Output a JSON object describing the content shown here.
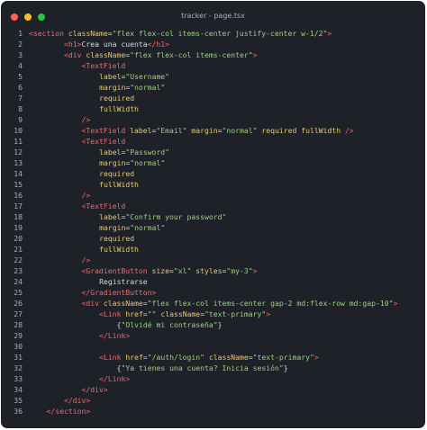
{
  "window": {
    "title": "tracker - page.tsx",
    "traffic_lights": [
      {
        "name": "close",
        "color": "#ff5f57"
      },
      {
        "name": "minimize",
        "color": "#febc2e"
      },
      {
        "name": "maximize",
        "color": "#28c840"
      }
    ]
  },
  "colors": {
    "background": "#1e2228",
    "line_number": "#a9aeb7",
    "tag": "#e36f6f",
    "attribute": "#e8c770",
    "string": "#9ad07f",
    "text": "#d6d8dc"
  },
  "code_lines": [
    {
      "n": "1",
      "indent": 0,
      "tokens": [
        [
          "tag",
          "<section "
        ],
        [
          "attr",
          "className"
        ],
        [
          "txtc",
          "="
        ],
        [
          "str",
          "\"flex flex-col items-center justify-center w-1/2\""
        ],
        [
          "tag",
          ">"
        ]
      ]
    },
    {
      "n": "2",
      "indent": 8,
      "tokens": [
        [
          "tag",
          "<h1>"
        ],
        [
          "txtc",
          "Crea una cuenta"
        ],
        [
          "tag",
          "</h1>"
        ]
      ]
    },
    {
      "n": "3",
      "indent": 8,
      "tokens": [
        [
          "tag",
          "<div "
        ],
        [
          "attr",
          "className"
        ],
        [
          "txtc",
          "="
        ],
        [
          "str",
          "\"flex flex-col items-center\""
        ],
        [
          "tag",
          ">"
        ]
      ]
    },
    {
      "n": "4",
      "indent": 12,
      "tokens": [
        [
          "tag",
          "<TextField"
        ]
      ]
    },
    {
      "n": "5",
      "indent": 16,
      "tokens": [
        [
          "attr",
          "label"
        ],
        [
          "txtc",
          "="
        ],
        [
          "str",
          "\"Username\""
        ]
      ]
    },
    {
      "n": "6",
      "indent": 16,
      "tokens": [
        [
          "attr",
          "margin"
        ],
        [
          "txtc",
          "="
        ],
        [
          "str",
          "\"normal\""
        ]
      ]
    },
    {
      "n": "7",
      "indent": 16,
      "tokens": [
        [
          "attr",
          "required"
        ]
      ]
    },
    {
      "n": "8",
      "indent": 16,
      "tokens": [
        [
          "attr",
          "fullWidth"
        ]
      ]
    },
    {
      "n": "9",
      "indent": 12,
      "tokens": [
        [
          "tag",
          "/>"
        ]
      ]
    },
    {
      "n": "10",
      "indent": 12,
      "tokens": [
        [
          "tag",
          "<TextField "
        ],
        [
          "attr",
          "label"
        ],
        [
          "txtc",
          "="
        ],
        [
          "str",
          "\"Email\""
        ],
        [
          "txtc",
          " "
        ],
        [
          "attr",
          "margin"
        ],
        [
          "txtc",
          "="
        ],
        [
          "str",
          "\"normal\""
        ],
        [
          "txtc",
          " "
        ],
        [
          "attr",
          "required"
        ],
        [
          "txtc",
          " "
        ],
        [
          "attr",
          "fullWidth"
        ],
        [
          "txtc",
          " "
        ],
        [
          "tag",
          "/>"
        ]
      ]
    },
    {
      "n": "11",
      "indent": 12,
      "tokens": [
        [
          "tag",
          "<TextField"
        ]
      ]
    },
    {
      "n": "12",
      "indent": 16,
      "tokens": [
        [
          "attr",
          "label"
        ],
        [
          "txtc",
          "="
        ],
        [
          "str",
          "\"Password\""
        ]
      ]
    },
    {
      "n": "13",
      "indent": 16,
      "tokens": [
        [
          "attr",
          "margin"
        ],
        [
          "txtc",
          "="
        ],
        [
          "str",
          "\"normal\""
        ]
      ]
    },
    {
      "n": "14",
      "indent": 16,
      "tokens": [
        [
          "attr",
          "required"
        ]
      ]
    },
    {
      "n": "15",
      "indent": 16,
      "tokens": [
        [
          "attr",
          "fullWidth"
        ]
      ]
    },
    {
      "n": "16",
      "indent": 12,
      "tokens": [
        [
          "tag",
          "/>"
        ]
      ]
    },
    {
      "n": "17",
      "indent": 12,
      "tokens": [
        [
          "tag",
          "<TextField"
        ]
      ]
    },
    {
      "n": "18",
      "indent": 16,
      "tokens": [
        [
          "attr",
          "label"
        ],
        [
          "txtc",
          "="
        ],
        [
          "str",
          "\"Confirm your password\""
        ]
      ]
    },
    {
      "n": "19",
      "indent": 16,
      "tokens": [
        [
          "attr",
          "margin"
        ],
        [
          "txtc",
          "="
        ],
        [
          "str",
          "\"normal\""
        ]
      ]
    },
    {
      "n": "20",
      "indent": 16,
      "tokens": [
        [
          "attr",
          "required"
        ]
      ]
    },
    {
      "n": "21",
      "indent": 16,
      "tokens": [
        [
          "attr",
          "fullWidth"
        ]
      ]
    },
    {
      "n": "22",
      "indent": 12,
      "tokens": [
        [
          "tag",
          "/>"
        ]
      ]
    },
    {
      "n": "23",
      "indent": 12,
      "tokens": [
        [
          "tag",
          "<GradientButton "
        ],
        [
          "attr",
          "size"
        ],
        [
          "txtc",
          "="
        ],
        [
          "str",
          "\"xl\""
        ],
        [
          "txtc",
          " "
        ],
        [
          "attr",
          "styles"
        ],
        [
          "txtc",
          "="
        ],
        [
          "str",
          "\"my-3\""
        ],
        [
          "tag",
          ">"
        ]
      ]
    },
    {
      "n": "24",
      "indent": 16,
      "tokens": [
        [
          "txtc",
          "Registrarse"
        ]
      ]
    },
    {
      "n": "25",
      "indent": 12,
      "tokens": [
        [
          "tag",
          "</GradientButton>"
        ]
      ]
    },
    {
      "n": "26",
      "indent": 12,
      "tokens": [
        [
          "tag",
          "<div "
        ],
        [
          "attr",
          "className"
        ],
        [
          "txtc",
          "="
        ],
        [
          "str",
          "\"flex flex-col items-center gap-2 md:flex-row md:gap-10\""
        ],
        [
          "tag",
          ">"
        ]
      ]
    },
    {
      "n": "27",
      "indent": 16,
      "tokens": [
        [
          "tag",
          "<Link "
        ],
        [
          "attr",
          "href"
        ],
        [
          "txtc",
          "="
        ],
        [
          "str",
          "\"\""
        ],
        [
          "txtc",
          " "
        ],
        [
          "attr",
          "className"
        ],
        [
          "txtc",
          "="
        ],
        [
          "str",
          "\"text-primary\""
        ],
        [
          "tag",
          ">"
        ]
      ]
    },
    {
      "n": "28",
      "indent": 20,
      "tokens": [
        [
          "txtc",
          "{"
        ],
        [
          "str",
          "\"Olvidé mi contraseña\""
        ],
        [
          "txtc",
          "}"
        ]
      ]
    },
    {
      "n": "29",
      "indent": 16,
      "tokens": [
        [
          "tag",
          "</Link>"
        ]
      ]
    },
    {
      "n": "30",
      "indent": 0,
      "tokens": []
    },
    {
      "n": "31",
      "indent": 16,
      "tokens": [
        [
          "tag",
          "<Link "
        ],
        [
          "attr",
          "href"
        ],
        [
          "txtc",
          "="
        ],
        [
          "str",
          "\"/auth/login\""
        ],
        [
          "txtc",
          " "
        ],
        [
          "attr",
          "className"
        ],
        [
          "txtc",
          "="
        ],
        [
          "str",
          "\"text-primary\""
        ],
        [
          "tag",
          ">"
        ]
      ]
    },
    {
      "n": "32",
      "indent": 20,
      "tokens": [
        [
          "txtc",
          "{"
        ],
        [
          "str",
          "\"Ya tienes una cuenta? Inicia sesión\""
        ],
        [
          "txtc",
          "}"
        ]
      ]
    },
    {
      "n": "33",
      "indent": 16,
      "tokens": [
        [
          "tag",
          "</Link>"
        ]
      ]
    },
    {
      "n": "34",
      "indent": 12,
      "tokens": [
        [
          "tag",
          "</div>"
        ]
      ]
    },
    {
      "n": "35",
      "indent": 8,
      "tokens": [
        [
          "tag",
          "</div>"
        ]
      ]
    },
    {
      "n": "36",
      "indent": 4,
      "tokens": [
        [
          "tag",
          "</section>"
        ]
      ]
    }
  ]
}
